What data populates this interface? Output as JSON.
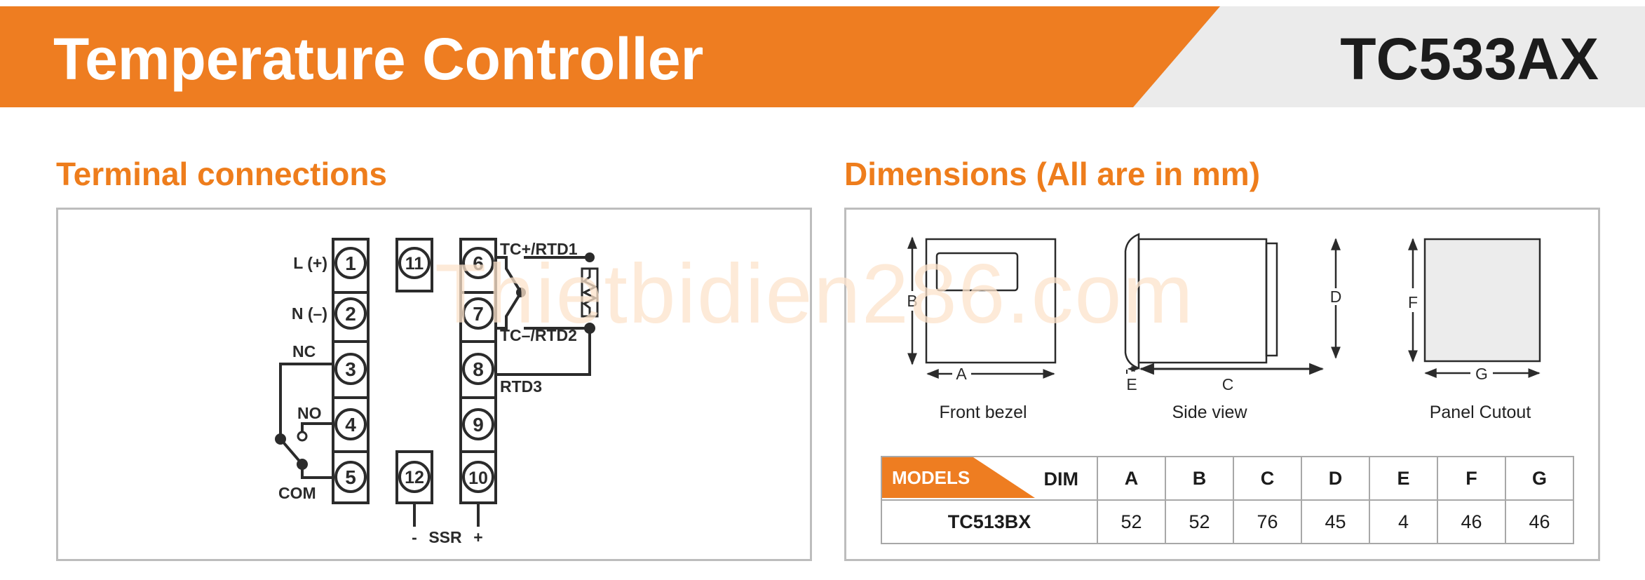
{
  "header": {
    "title": "Temperature Controller",
    "model": "TC533AX",
    "accent_color": "#ee7d21",
    "secondary_color": "#ebebeb"
  },
  "terminal_section": {
    "title": "Terminal connections",
    "terminals": [
      {
        "num": "1",
        "label": "L (+)"
      },
      {
        "num": "2",
        "label": "N (–)"
      },
      {
        "num": "3",
        "label": "NC"
      },
      {
        "num": "4",
        "label": "NO"
      },
      {
        "num": "5",
        "label": "COM"
      },
      {
        "num": "6",
        "label": "TC+/RTD1"
      },
      {
        "num": "7",
        "label": "TC–/RTD2"
      },
      {
        "num": "8",
        "label": "RTD3"
      },
      {
        "num": "9",
        "label": ""
      },
      {
        "num": "10",
        "label": ""
      },
      {
        "num": "11",
        "label": ""
      },
      {
        "num": "12",
        "label": ""
      }
    ],
    "ssr": {
      "minus": "-",
      "label": "SSR",
      "plus": "+"
    }
  },
  "watermark": "Thietbidien286.com",
  "dimensions_section": {
    "title": "Dimensions (All are in mm)",
    "views": {
      "front": {
        "caption": "Front bezel",
        "labels": [
          "B",
          "A"
        ]
      },
      "side": {
        "caption": "Side view",
        "labels": [
          "D",
          "E",
          "C"
        ]
      },
      "cutout": {
        "caption": "Panel Cutout",
        "labels": [
          "F",
          "G"
        ]
      }
    },
    "table": {
      "models_label": "MODELS",
      "dim_label": "DIM",
      "columns": [
        "A",
        "B",
        "C",
        "D",
        "E",
        "F",
        "G"
      ],
      "rows": [
        {
          "model": "TC513BX",
          "values": [
            "52",
            "52",
            "76",
            "45",
            "4",
            "46",
            "46"
          ]
        }
      ]
    }
  }
}
